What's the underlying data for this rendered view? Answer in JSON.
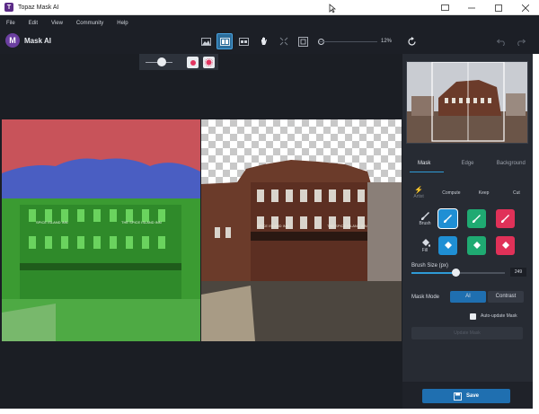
{
  "window": {
    "title": "Topaz Mask AI",
    "logo_letter": "T"
  },
  "menu": [
    "File",
    "Edit",
    "View",
    "Community",
    "Help"
  ],
  "app": {
    "brand": "Mask AI",
    "brand_letter": "M"
  },
  "toolbar": {
    "pan_label": "Pan",
    "fit_label": "Fit",
    "zoom_100_label": "100%",
    "zoom_value": "12%",
    "reset_label": "Reset",
    "undo_label": "Undo",
    "redo_label": "Redo"
  },
  "panel": {
    "tabs": [
      "Mask",
      "Edge",
      "Background"
    ],
    "active_tab": "Mask",
    "modes": [
      "Artist",
      "Compute",
      "Keep",
      "Cut"
    ],
    "brush_label": "Brush",
    "fill_label": "Fill",
    "brush_size_label": "Brush Size (px)",
    "brush_size_value": "249",
    "brush_size_fraction": 0.5,
    "mask_mode_label": "Mask Mode",
    "mask_mode_ai": "AI",
    "mask_mode_contrast": "Contrast",
    "auto_update_label": "Auto-update Mask",
    "update_mask_label": "Update Mask",
    "save_label": "Save"
  },
  "canvas": {
    "left_sign": "SPICE ISLAND INN",
    "left_sign_2": "THE SPICE ISLAND INN",
    "right_sign": "SPICE ISLAND INN",
    "right_sign_2": "THE SPICE ISLAND INN"
  },
  "colors": {
    "keep": "#1faa72",
    "cut": "#e03158",
    "compute": "#1f8fd4",
    "accent": "#2f9bd6"
  }
}
